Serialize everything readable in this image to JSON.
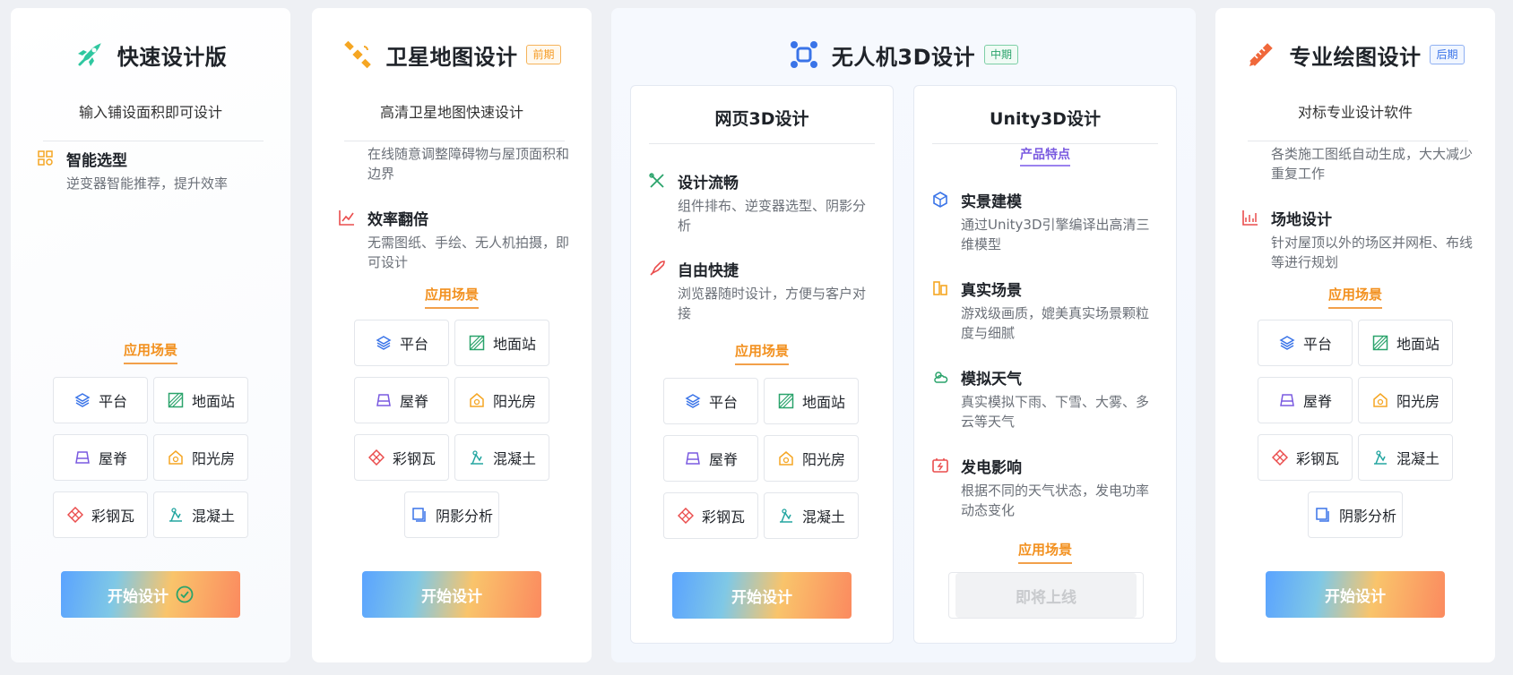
{
  "cards": {
    "quick": {
      "title": "快速设计版",
      "subtitle": "输入铺设面积即可设计",
      "features": [
        {
          "title": "智能选型",
          "desc": "逆变器智能推荐，提升效率"
        }
      ],
      "scene_label": "应用场景",
      "scenes": [
        "平台",
        "地面站",
        "屋脊",
        "阳光房",
        "彩钢瓦",
        "混凝土"
      ],
      "button": "开始设计"
    },
    "satellite": {
      "title": "卫星地图设计",
      "tag": "前期",
      "subtitle": "高清卫星地图快速设计",
      "features": [
        {
          "title": "",
          "desc": "在线随意调整障碍物与屋顶面积和边界"
        },
        {
          "title": "效率翻倍",
          "desc": "无需图纸、手绘、无人机拍摄，即可设计"
        }
      ],
      "scene_label": "应用场景",
      "scenes": [
        "平台",
        "地面站",
        "屋脊",
        "阳光房",
        "彩钢瓦",
        "混凝土",
        "阴影分析"
      ],
      "button": "开始设计"
    },
    "drone": {
      "title": "无人机3D设计",
      "tag": "中期",
      "web": {
        "title": "网页3D设计",
        "features": [
          {
            "title": "设计流畅",
            "desc": "组件排布、逆变器选型、阴影分析"
          },
          {
            "title": "自由快捷",
            "desc": "浏览器随时设计，方便与客户对接"
          }
        ],
        "scene_label": "应用场景",
        "scenes": [
          "平台",
          "地面站",
          "屋脊",
          "阳光房",
          "彩钢瓦",
          "混凝土"
        ],
        "button": "开始设计"
      },
      "unity": {
        "title": "Unity3D设计",
        "section": "产品特点",
        "features": [
          {
            "title": "实景建模",
            "desc": "通过Unity3D引擎编译出高清三维模型"
          },
          {
            "title": "真实场景",
            "desc": "游戏级画质，媲美真实场景颗粒度与细腻"
          },
          {
            "title": "模拟天气",
            "desc": "真实模拟下雨、下雪、大雾、多云等天气"
          },
          {
            "title": "发电影响",
            "desc": "根据不同的天气状态，发电功率动态变化"
          }
        ],
        "scene_label": "应用场景",
        "button": "即将上线"
      }
    },
    "pro": {
      "title": "专业绘图设计",
      "tag": "后期",
      "subtitle": "对标专业设计软件",
      "features": [
        {
          "title": "",
          "desc": "各类施工图纸自动生成，大大减少重复工作"
        },
        {
          "title": "场地设计",
          "desc": "针对屋顶以外的场区并网柜、布线等进行规划"
        }
      ],
      "scene_label": "应用场景",
      "scenes": [
        "平台",
        "地面站",
        "屋脊",
        "阳光房",
        "彩钢瓦",
        "混凝土",
        "阴影分析"
      ],
      "button": "开始设计"
    }
  },
  "colors": {
    "scene_orange": "#f2901e",
    "tag_orange": "#f59a23",
    "tag_green": "#2aa36b",
    "tag_blue": "#3a74e8"
  },
  "icons": {
    "platform": "layers-icon",
    "ground": "ground-station-icon",
    "ridge": "roof-ridge-icon",
    "sunroom": "sunroom-icon",
    "steel": "steel-tile-icon",
    "concrete": "concrete-icon",
    "shadow": "shadow-analysis-icon"
  }
}
